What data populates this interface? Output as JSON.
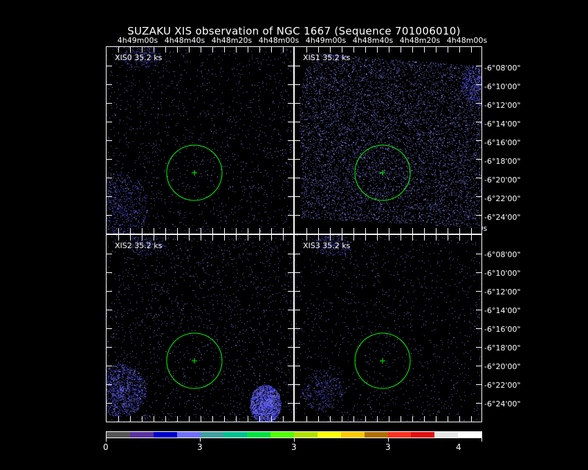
{
  "title": "SUZAKU XIS observation of NGC 1667  (Sequence 701006010)",
  "ra_labels_top": [
    "4h49m00s",
    "4h48m40s",
    "4h48m20s",
    "4h48m00s"
  ],
  "ra_labels_mid": [
    "4h49m00s",
    "4h48m40s",
    "4h48m20s",
    "4h48m00s"
  ],
  "dec_labels_top": [
    "-6°08'00\"",
    "-6°10'00\"",
    "-6°12'00\"",
    "-6°14'00\"",
    "-6°16'00\"",
    "-6°18'00\"",
    "-6°20'00\"",
    "-6°22'00\"",
    "-6°24'00\""
  ],
  "dec_labels_bottom": [
    "-6°08'00\"",
    "-6°10'00\"",
    "-6°12'00\"",
    "-6°14'00\"",
    "-6°16'00\"",
    "-6°18'00\"",
    "-6°20'00\"",
    "-6°22'00\"",
    "-6°24'00\""
  ],
  "panels": [
    {
      "label": "XIS0  35.2  ks"
    },
    {
      "label": "XIS1  35.2  ks"
    },
    {
      "label": "XIS2  35.2  ks"
    },
    {
      "label": "XIS3  35.2  ks"
    }
  ],
  "colorbar": {
    "colors": [
      "#555555",
      "#5a32a0",
      "#0000c8",
      "#7070ff",
      "#40a0a0",
      "#00c090",
      "#00e040",
      "#50ff00",
      "#b0e000",
      "#ffff00",
      "#ffc800",
      "#b07000",
      "#ff3020",
      "#e01010",
      "#e6e6e6",
      "#ffffff"
    ],
    "labels": [
      "0",
      "3",
      "3",
      "3",
      "4"
    ]
  },
  "accent": {
    "circle": "#00ff00",
    "counts": "#8080ff"
  }
}
